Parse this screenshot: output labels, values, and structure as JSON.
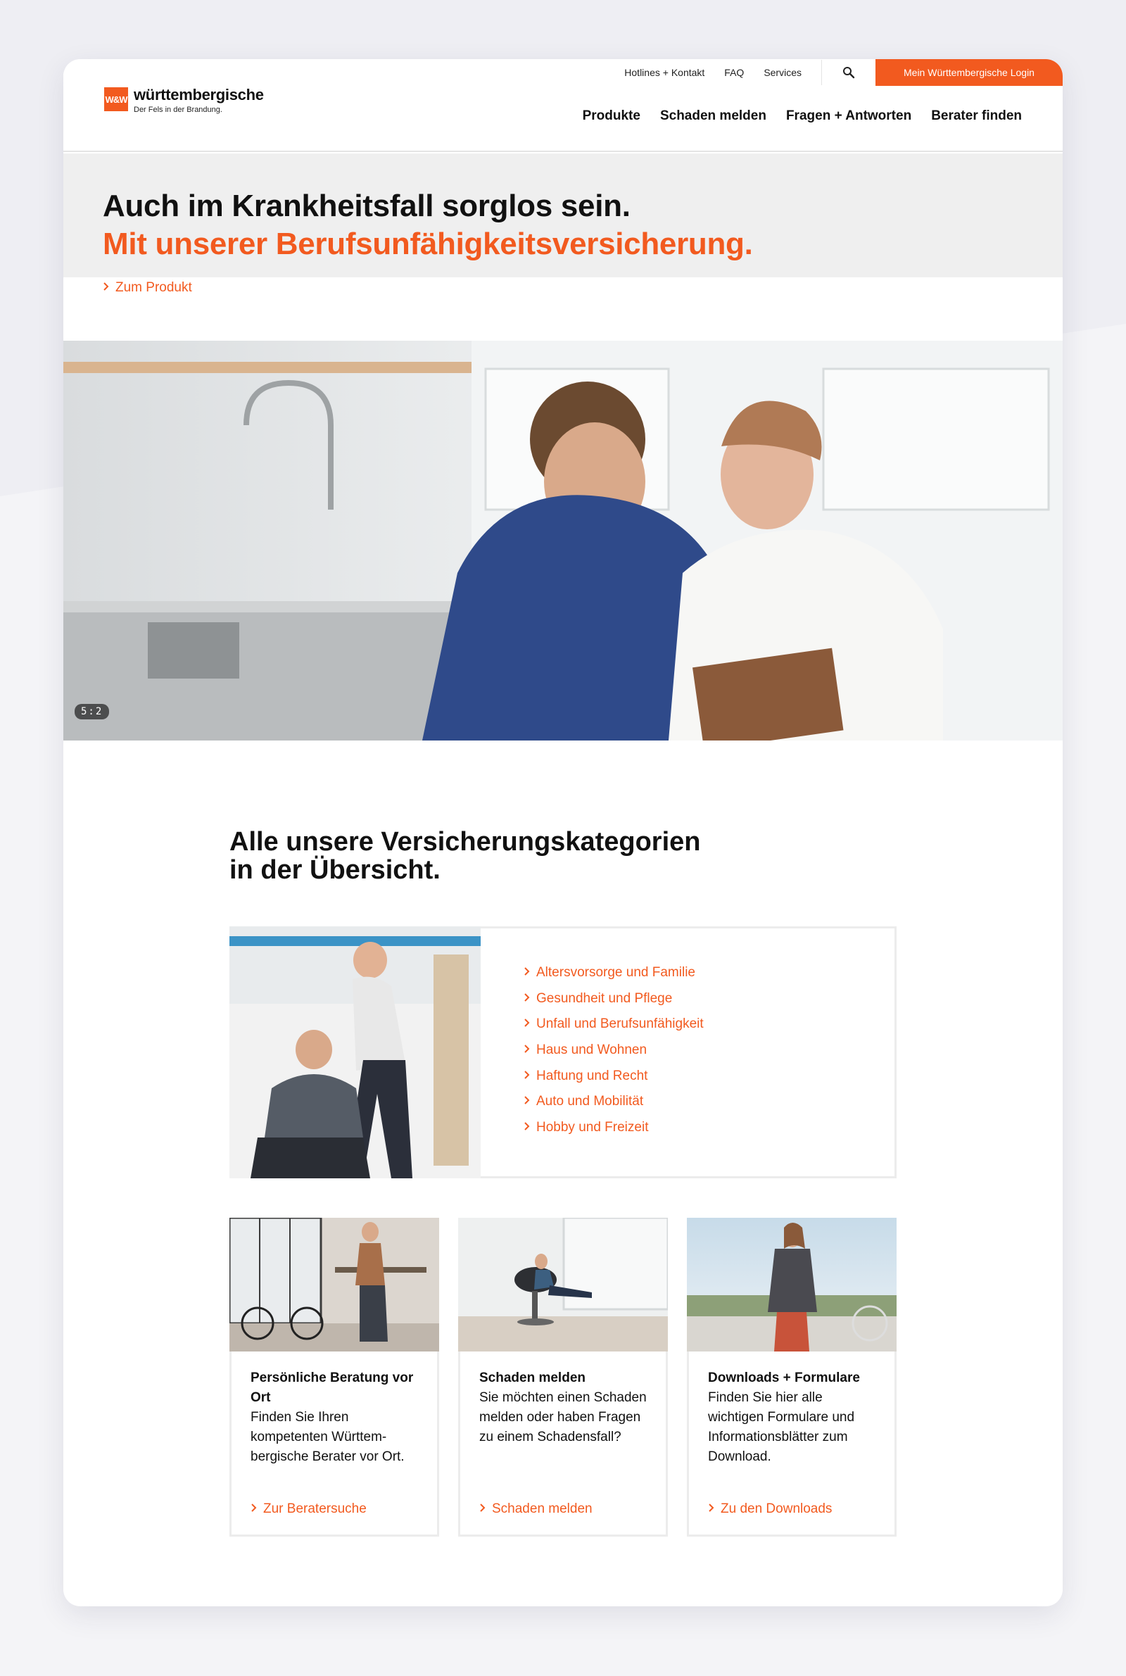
{
  "utility_nav": {
    "hotlines": "Hotlines + Kontakt",
    "faq": "FAQ",
    "services": "Services",
    "login": "Mein Württembergische Login"
  },
  "logo": {
    "mark": "W&W",
    "brand": "württembergische",
    "claim": "Der Fels in der Brandung."
  },
  "main_nav": [
    "Produkte",
    "Schaden melden",
    "Fragen + Antworten",
    "Berater finden"
  ],
  "hero": {
    "title_line1": "Auch im Krankheitsfall sorglos sein.",
    "title_line2": "Mit unserer Berufsunfähigkeitsversicherung.",
    "link": "Zum Produkt",
    "ratio_badge": "5:2"
  },
  "categories": {
    "title_line1": "Alle unsere Versicherungskategorien",
    "title_line2": "in der Übersicht.",
    "items": [
      "Altersvorsorge und Familie",
      "Gesundheit und Pflege",
      "Unfall und Berufsunfähigkeit",
      "Haus und Wohnen",
      "Haftung und Recht",
      "Auto und Mobilität",
      "Hobby und Freizeit"
    ]
  },
  "tiles": [
    {
      "title": "Persönliche Beratung vor Ort",
      "text": "Finden Sie Ihren kompetenten Württem-bergische Berater vor Ort.",
      "link": "Zur Beratersuche"
    },
    {
      "title": "Schaden melden",
      "text": "Sie möchten einen Schaden melden oder haben Fragen zu einem Schadensfall?",
      "link": "Schaden melden"
    },
    {
      "title": "Downloads + Formulare",
      "text": "Finden Sie hier alle wichtigen Formulare und Informationsblätter zum Download.",
      "link": "Zu den Downloads"
    }
  ],
  "colors": {
    "accent": "#f25a1f",
    "text": "#111111",
    "hero_bg": "#efefef"
  }
}
